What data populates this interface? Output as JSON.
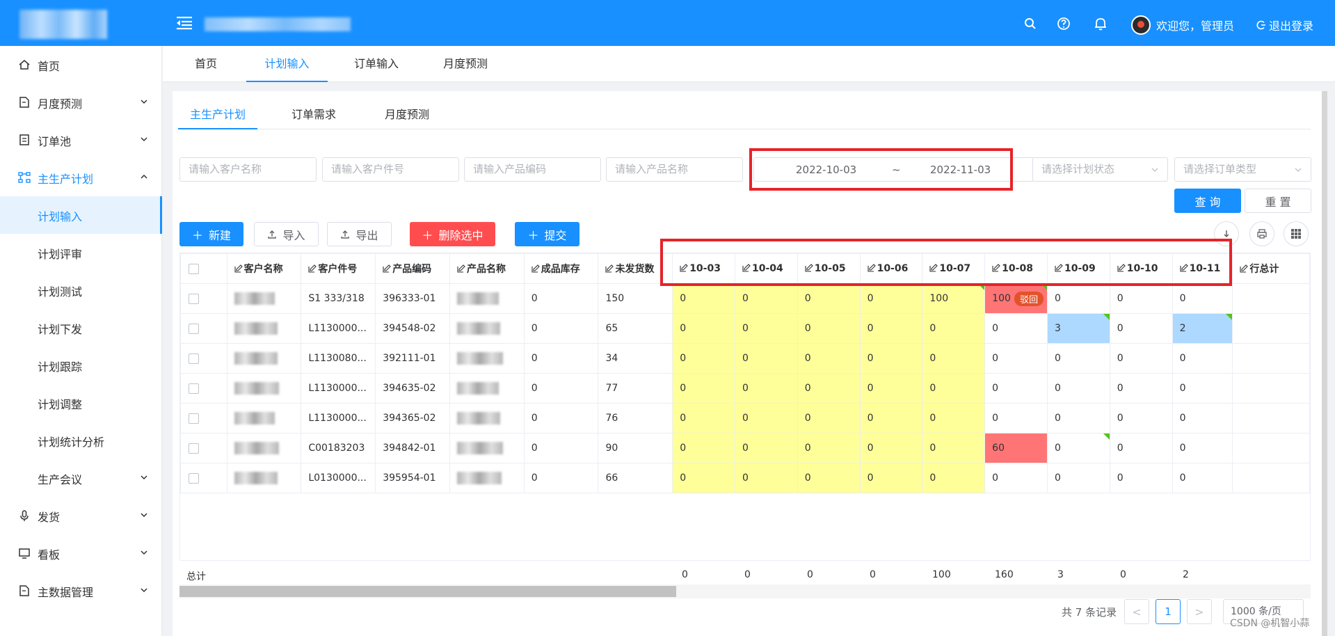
{
  "header": {
    "welcome": "欢迎您，管理员",
    "logout": "退出登录",
    "icons": [
      "search-icon",
      "help-icon",
      "bell-icon"
    ]
  },
  "sidebar": {
    "items": [
      {
        "label": "首页"
      },
      {
        "label": "月度预测"
      },
      {
        "label": "订单池"
      },
      {
        "label": "主生产计划"
      },
      {
        "label": "计划输入"
      },
      {
        "label": "计划评审"
      },
      {
        "label": "计划测试"
      },
      {
        "label": "计划下发"
      },
      {
        "label": "计划跟踪"
      },
      {
        "label": "计划调整"
      },
      {
        "label": "计划统计分析"
      },
      {
        "label": "生产会议"
      },
      {
        "label": "发货"
      },
      {
        "label": "看板"
      },
      {
        "label": "主数据管理"
      }
    ]
  },
  "page_tabs": [
    "首页",
    "计划输入",
    "订单输入",
    "月度预测"
  ],
  "sub_tabs": [
    "主生产计划",
    "订单需求",
    "月度预测"
  ],
  "filters": {
    "customer_name": "请输入客户名称",
    "customer_part": "请输入客户件号",
    "product_code": "请输入产品编码",
    "product_name": "请输入产品名称",
    "date_start": "2022-10-03",
    "date_sep": "~",
    "date_end": "2022-11-03",
    "plan_status": "请选择计划状态",
    "order_type": "请选择订单类型"
  },
  "buttons": {
    "query": "查 询",
    "reset": "重 置",
    "new": "新建",
    "import": "导入",
    "export": "导出",
    "delete_selected": "删除选中",
    "submit": "提交"
  },
  "table": {
    "headers": [
      "客户名称",
      "客户件号",
      "产品编码",
      "产品名称",
      "成品库存",
      "未发货数",
      "10-03",
      "10-04",
      "10-05",
      "10-06",
      "10-07",
      "10-08",
      "10-09",
      "10-10",
      "10-11",
      "行总计"
    ],
    "rows": [
      {
        "part": "S1 333/318",
        "code": "396333-01",
        "stock": "0",
        "unshipped": "150",
        "days": [
          "0",
          "0",
          "0",
          "0",
          "100",
          "100",
          "0",
          "0",
          "0"
        ]
      },
      {
        "part": "L1130000...",
        "code": "394548-02",
        "stock": "0",
        "unshipped": "65",
        "days": [
          "0",
          "0",
          "0",
          "0",
          "0",
          "0",
          "3",
          "0",
          "2"
        ]
      },
      {
        "part": "L1130080...",
        "code": "392111-01",
        "stock": "0",
        "unshipped": "34",
        "days": [
          "0",
          "0",
          "0",
          "0",
          "0",
          "0",
          "0",
          "0",
          "0"
        ]
      },
      {
        "part": "L1130000...",
        "code": "394635-02",
        "stock": "0",
        "unshipped": "77",
        "days": [
          "0",
          "0",
          "0",
          "0",
          "0",
          "0",
          "0",
          "0",
          "0"
        ]
      },
      {
        "part": "L1130000...",
        "code": "394365-02",
        "stock": "0",
        "unshipped": "76",
        "days": [
          "0",
          "0",
          "0",
          "0",
          "0",
          "0",
          "0",
          "0",
          "0"
        ]
      },
      {
        "part": "C00183203",
        "code": "394842-01",
        "stock": "0",
        "unshipped": "90",
        "days": [
          "0",
          "0",
          "0",
          "0",
          "0",
          "60",
          "0",
          "0",
          "0"
        ]
      },
      {
        "part": "L0130000...",
        "code": "395954-01",
        "stock": "0",
        "unshipped": "66",
        "days": [
          "0",
          "0",
          "0",
          "0",
          "0",
          "0",
          "0",
          "0",
          "0"
        ]
      }
    ],
    "reject_label": "驳回",
    "total_label": "总计",
    "totals": [
      "0",
      "0",
      "0",
      "0",
      "100",
      "160",
      "3",
      "0",
      "2"
    ]
  },
  "pagination": {
    "summary": "共 7 条记录",
    "prev": "<",
    "page": "1",
    "next": ">",
    "page_size": "1000 条/页"
  },
  "watermark": "CSDN @机智小蒜",
  "colors": {
    "primary": "#1890ff",
    "yellow": "#ffff99",
    "red": "#ff7575",
    "blue": "#add8ff",
    "danger": "#ff4d4f"
  }
}
